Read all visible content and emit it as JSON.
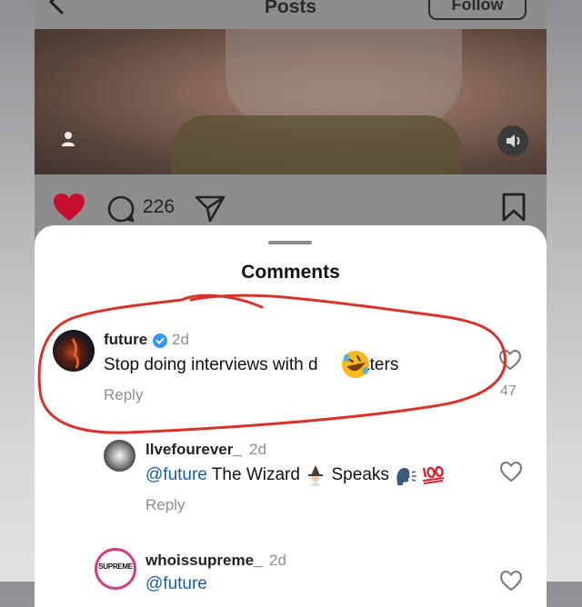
{
  "header": {
    "title": "Posts",
    "follow_label": "Follow"
  },
  "post": {
    "comment_count": "226"
  },
  "comments_sheet": {
    "title": "Comments",
    "comments": [
      {
        "username": "future",
        "verified": true,
        "time": "2d",
        "text_before": "Stop doing interviews with d",
        "text_after": "eaters",
        "reply_label": "Reply",
        "like_count": "47"
      },
      {
        "username": "llvefourever_",
        "time": "2d",
        "mention": "@future",
        "text": " The Wizard ",
        "text2": " Speaks ",
        "reply_label": "Reply"
      },
      {
        "username": "whoissupreme_",
        "time": "2d",
        "mention": "@future",
        "avatar_text": "SUPREME"
      }
    ]
  },
  "colors": {
    "highlight": "#d9322b",
    "heart": "#c8102e",
    "mention": "#1b5fa6",
    "verified": "#3797f0"
  },
  "icons": [
    "back-icon",
    "user-tag-icon",
    "sound-icon",
    "heart-icon",
    "comment-icon",
    "share-icon",
    "bookmark-icon",
    "verified-icon",
    "like-icon"
  ]
}
